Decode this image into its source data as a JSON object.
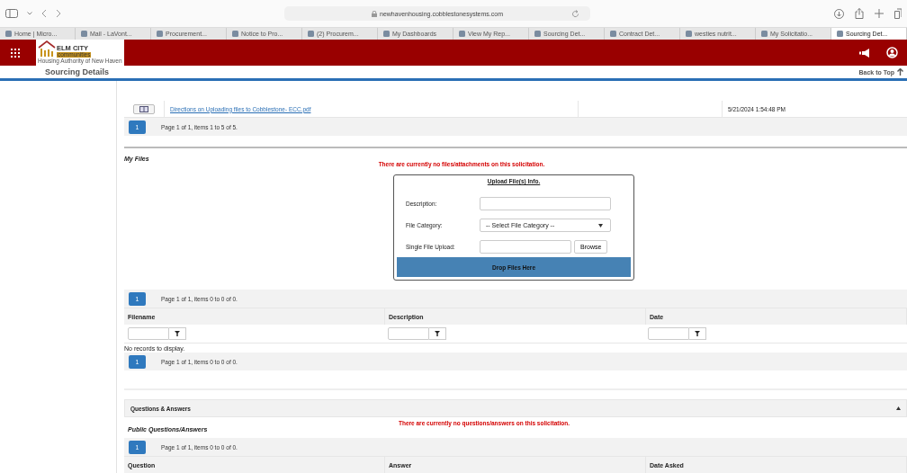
{
  "browser": {
    "url": "newhavenhousing.cobblestonesystems.com",
    "tabs": [
      {
        "label": "Home | Micro...",
        "selected": false
      },
      {
        "label": "Mail - LaVont...",
        "selected": false
      },
      {
        "label": "Procurement...",
        "selected": false
      },
      {
        "label": "Notice to Pro...",
        "selected": false
      },
      {
        "label": "(2) Procurem...",
        "selected": false
      },
      {
        "label": "My Dashboards",
        "selected": false
      },
      {
        "label": "View My Rep...",
        "selected": false
      },
      {
        "label": "Sourcing Det...",
        "selected": false
      },
      {
        "label": "Contract Det...",
        "selected": false
      },
      {
        "label": "westies nutrit...",
        "selected": false
      },
      {
        "label": "My Solicitatio...",
        "selected": false
      },
      {
        "label": "Sourcing Det...",
        "selected": true
      }
    ]
  },
  "header": {
    "logo_title": "ELM CITY",
    "logo_subtitle": "communities",
    "logo_tagline": "Housing Authority of New Haven"
  },
  "page_title": "Sourcing Details",
  "back_to_top": "Back to Top",
  "documents": {
    "row": {
      "file": "Directions on Uploading files to Cobblestone- ECC.pdf",
      "date": "5/21/2024 1:54:48 PM"
    },
    "pager": {
      "page": "1",
      "info": "Page 1 of 1, items 1 to 5 of 5."
    }
  },
  "my_files": {
    "title": "My Files",
    "message": "There are currently no files/attachments on this solicitation.",
    "upload": {
      "title": "Upload File(s) Info.",
      "fields": [
        {
          "kind": "text",
          "label": "Description:"
        },
        {
          "kind": "select",
          "label": "File Category:",
          "value": "-- Select File Category --"
        },
        {
          "kind": "file",
          "label": "Single File Upload:",
          "button": "Browse"
        }
      ],
      "drop_label": "Drop Files Here"
    },
    "pager_top": {
      "page": "1",
      "info": "Page 1 of 1, items 0 to 0 of 0."
    },
    "columns": [
      "Filename",
      "Description",
      "Date"
    ],
    "no_records": "No records to display.",
    "pager_bottom": {
      "page": "1",
      "info": "Page 1 of 1, items 0 to 0 of 0."
    }
  },
  "qa": {
    "title": "Questions & Answers",
    "expanded": true,
    "message": "There are currently no questions/answers on this solicitation.",
    "subtitle": "Public Questions/Answers",
    "pager": {
      "page": "1",
      "info": "Page 1 of 1, items 0 to 0 of 0."
    },
    "columns": [
      "Question",
      "Answer",
      "Date Asked"
    ]
  }
}
